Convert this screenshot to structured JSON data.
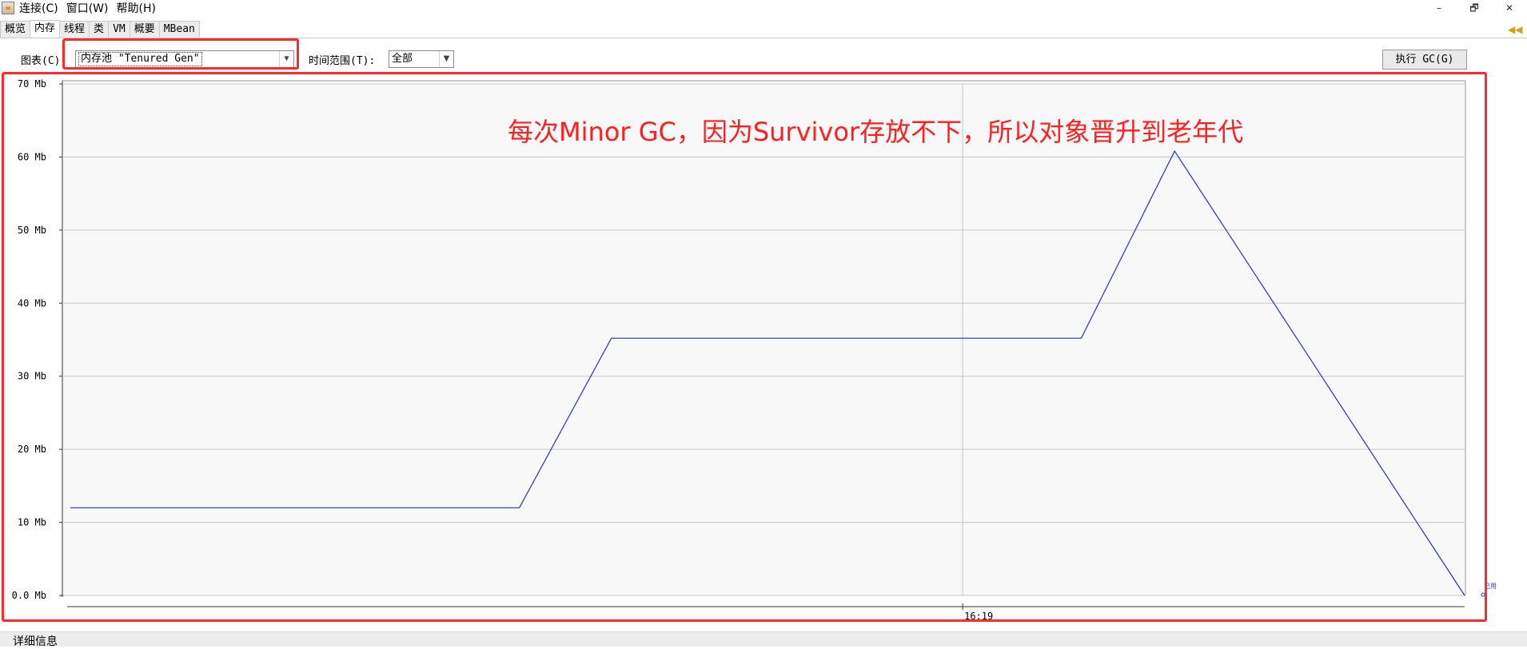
{
  "menubar": {
    "items": [
      "连接(C)",
      "窗口(W)",
      "帮助(H)"
    ],
    "window_controls": [
      "–",
      "🗗",
      "✕"
    ]
  },
  "tabs": [
    "概览",
    "内存",
    "线程",
    "类",
    "VM",
    "概要",
    "MBean"
  ],
  "active_tab": "内存",
  "toolbar": {
    "chart_label": "图表(C):",
    "chart_select_value": "内存池 \"Tenured Gen\"",
    "time_range_label": "时间范围(T):",
    "time_range_value": "全部",
    "gc_button": "执行 GC(G)"
  },
  "annotation": "每次Minor GC，因为Survivor存放不下，所以对象晋升到老年代",
  "footer": {
    "details_label": "详细信息"
  },
  "colors": {
    "highlight": "#ff2a2a",
    "series": "#2233bb",
    "annotation": "#ff1f1f"
  },
  "chart_data": {
    "type": "line",
    "y_ticks": [
      "70 Mb",
      "60 Mb",
      "50 Mb",
      "40 Mb",
      "30 Mb",
      "20 Mb",
      "10 Mb",
      "0.0 Mb"
    ],
    "y_unit": "Mb",
    "ylim": [
      0,
      70
    ],
    "x_tick_label": "16:19",
    "x_tick_fraction": 0.64,
    "grid": true,
    "legend_label": "已用",
    "series": [
      {
        "points": [
          [
            0.0,
            12.0
          ],
          [
            0.322,
            12.0
          ],
          [
            0.388,
            35.2
          ],
          [
            0.725,
            35.2
          ],
          [
            0.792,
            60.8
          ],
          [
            1.0,
            0.0
          ]
        ]
      }
    ]
  }
}
